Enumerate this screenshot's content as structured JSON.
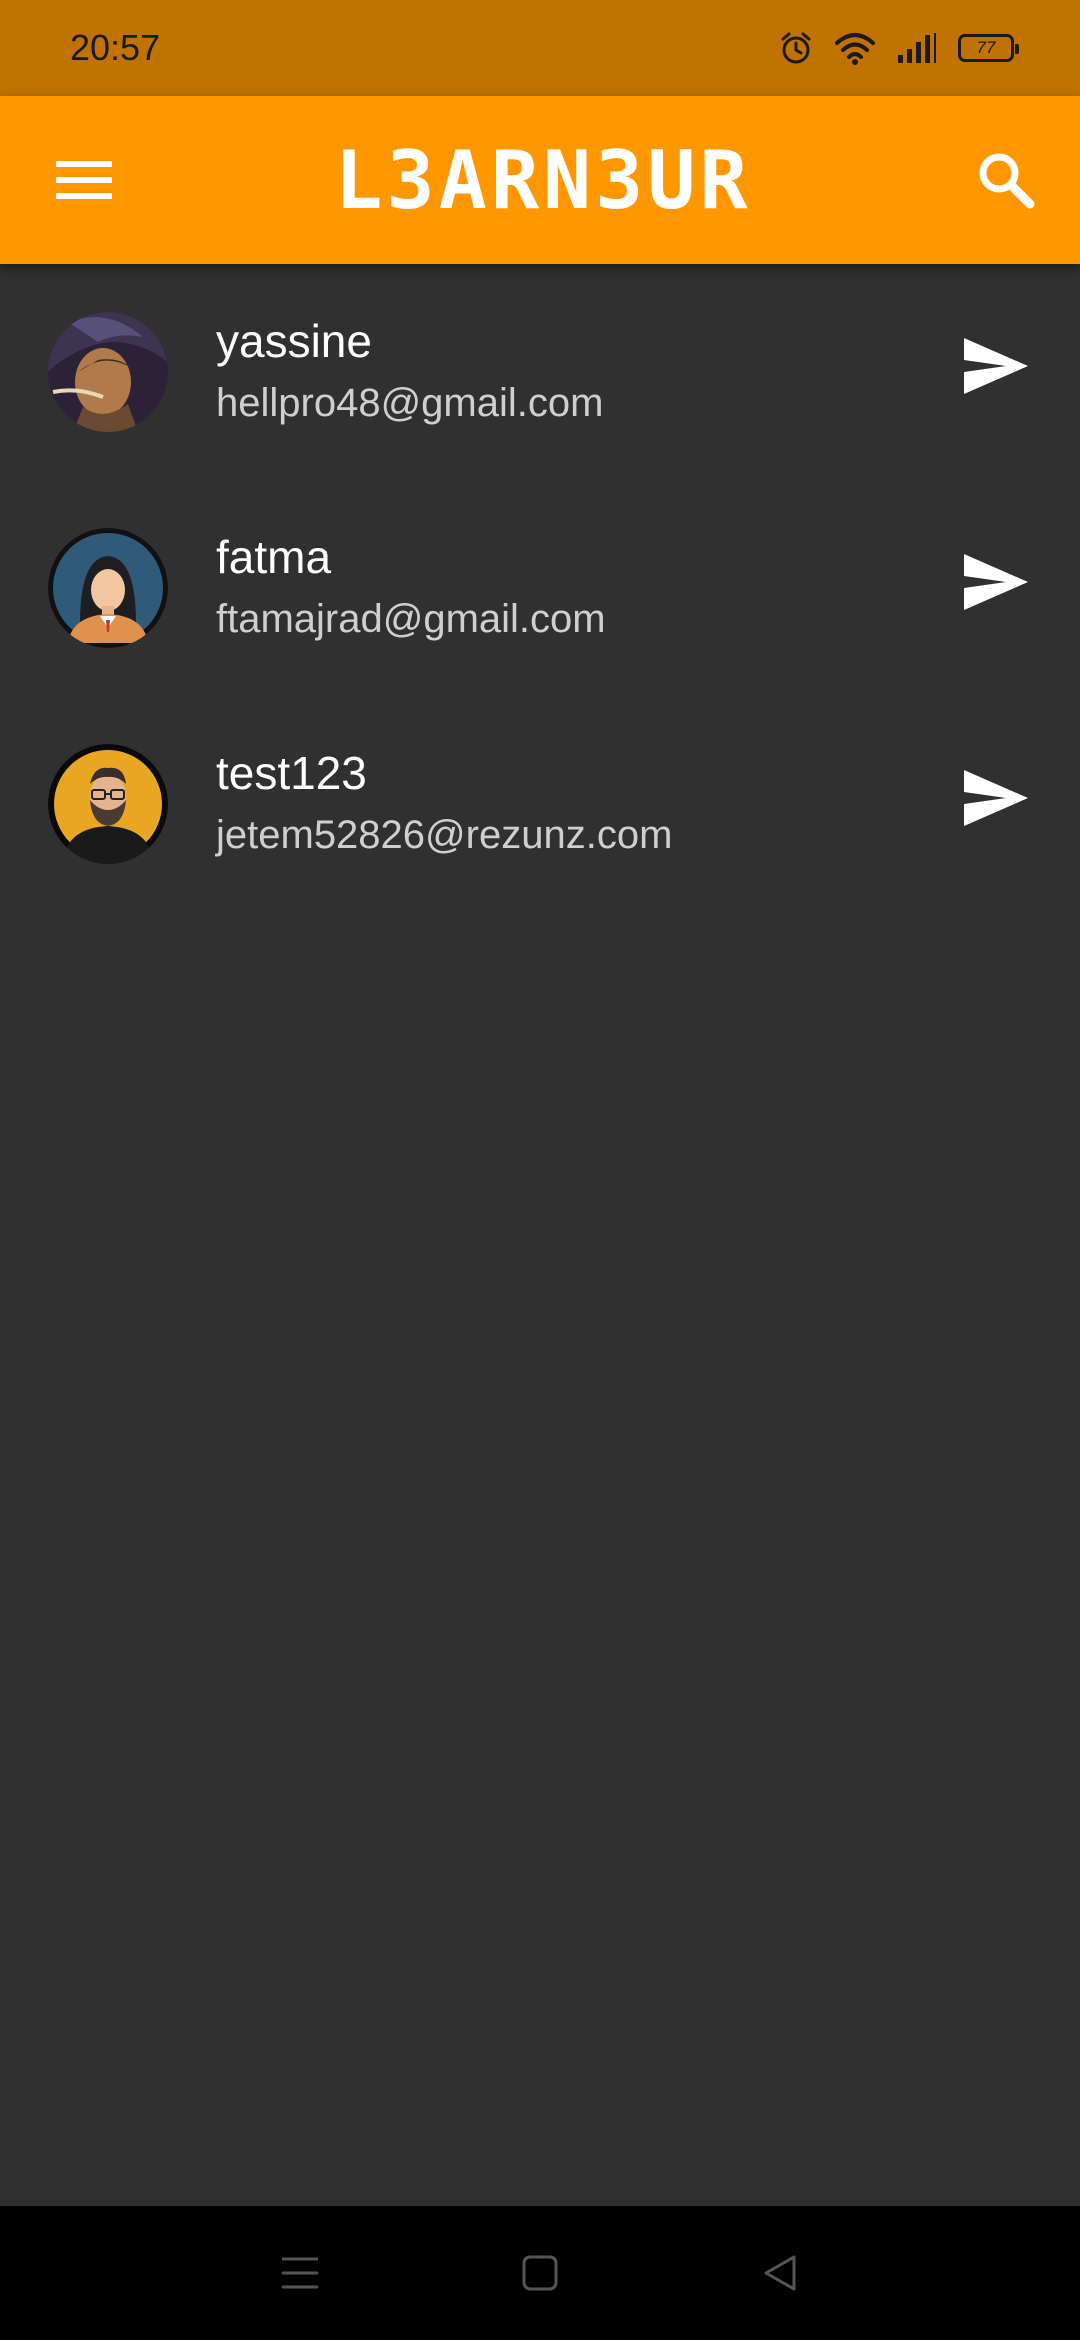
{
  "status_bar": {
    "time": "20:57",
    "battery": "77",
    "icons": [
      "alarm-icon",
      "wifi-icon",
      "signal-icon",
      "battery-icon"
    ]
  },
  "app_bar": {
    "title": "L3ARN3UR",
    "menu_icon": "hamburger-menu-icon",
    "search_icon": "search-icon",
    "background": "#ff9800"
  },
  "users": [
    {
      "name": "yassine",
      "email": "hellpro48@gmail.com",
      "avatar": "warrior-avatar"
    },
    {
      "name": "fatma",
      "email": "ftamajrad@gmail.com",
      "avatar": "woman-avatar"
    },
    {
      "name": "test123",
      "email": "jetem52826@rezunz.com",
      "avatar": "bearded-man-avatar"
    }
  ],
  "nav_bar": {
    "icons": [
      "recent-apps-icon",
      "home-icon",
      "back-icon"
    ]
  },
  "colors": {
    "status_bar": "#c07300",
    "background": "#303030",
    "accent": "#ff9800"
  }
}
